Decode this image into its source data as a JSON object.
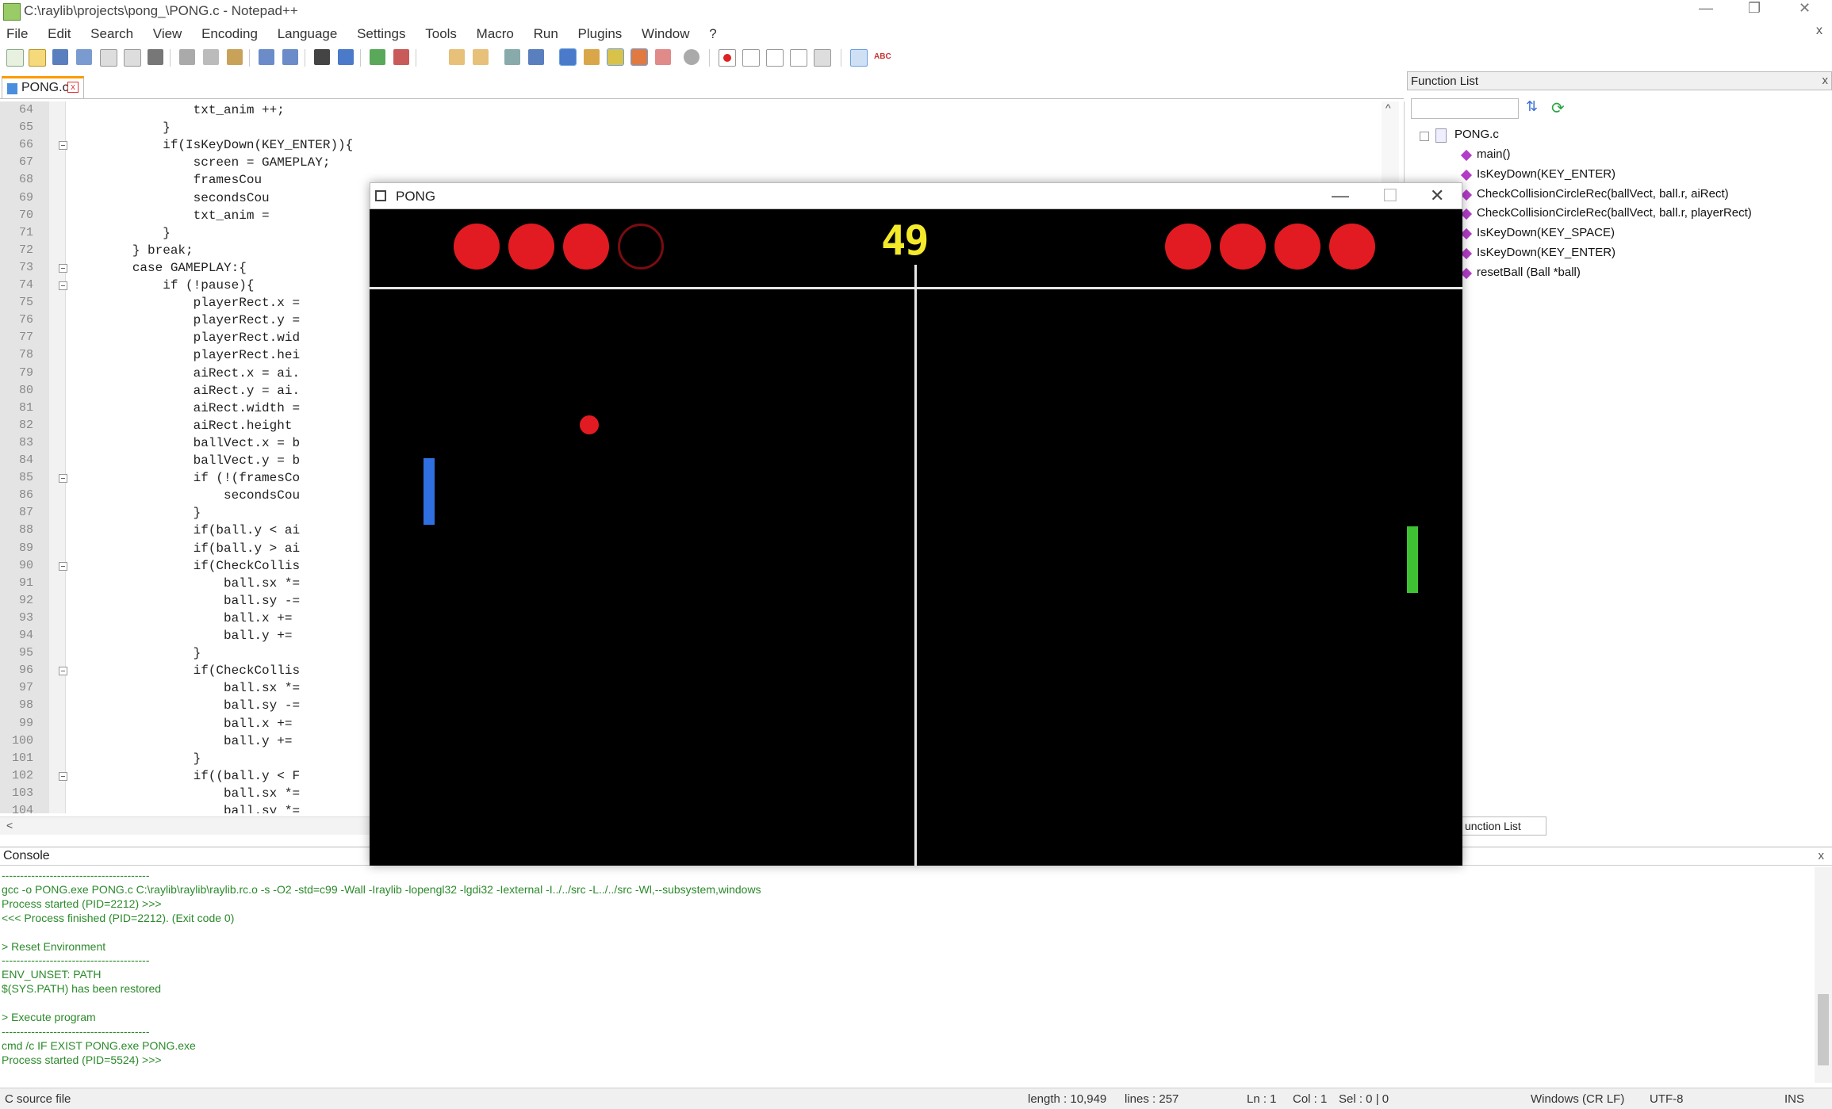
{
  "window": {
    "title": "C:\\raylib\\projects\\pong_\\PONG.c - Notepad++",
    "minimize": "—",
    "restore": "❐",
    "close": "✕",
    "doc_close": "x"
  },
  "menu": [
    "File",
    "Edit",
    "Search",
    "View",
    "Encoding",
    "Language",
    "Settings",
    "Tools",
    "Macro",
    "Run",
    "Plugins",
    "Window",
    "?"
  ],
  "tab": {
    "label": "PONG.c",
    "close": "x"
  },
  "editor": {
    "lines": [
      {
        "n": "64",
        "code": "                txt_anim ++;"
      },
      {
        "n": "65",
        "code": "            }"
      },
      {
        "n": "66",
        "code": "            if(IsKeyDown(KEY_ENTER)){"
      },
      {
        "n": "67",
        "code": "                screen = GAMEPLAY;"
      },
      {
        "n": "68",
        "code": "                framesCou"
      },
      {
        "n": "69",
        "code": "                secondsCou"
      },
      {
        "n": "70",
        "code": "                txt_anim ="
      },
      {
        "n": "71",
        "code": "            }"
      },
      {
        "n": "72",
        "code": "        } break;"
      },
      {
        "n": "73",
        "code": "        case GAMEPLAY:{"
      },
      {
        "n": "74",
        "code": "            if (!pause){"
      },
      {
        "n": "75",
        "code": "                playerRect.x ="
      },
      {
        "n": "76",
        "code": "                playerRect.y ="
      },
      {
        "n": "77",
        "code": "                playerRect.wid"
      },
      {
        "n": "78",
        "code": "                playerRect.hei"
      },
      {
        "n": "79",
        "code": "                aiRect.x = ai."
      },
      {
        "n": "80",
        "code": "                aiRect.y = ai."
      },
      {
        "n": "81",
        "code": "                aiRect.width ="
      },
      {
        "n": "82",
        "code": "                aiRect.height"
      },
      {
        "n": "83",
        "code": "                ballVect.x = b"
      },
      {
        "n": "84",
        "code": "                ballVect.y = b"
      },
      {
        "n": "85",
        "code": "                if (!(framesCo"
      },
      {
        "n": "86",
        "code": "                    secondsCou"
      },
      {
        "n": "87",
        "code": "                }"
      },
      {
        "n": "88",
        "code": "                if(ball.y < ai"
      },
      {
        "n": "89",
        "code": "                if(ball.y > ai"
      },
      {
        "n": "90",
        "code": "                if(CheckCollis"
      },
      {
        "n": "91",
        "code": "                    ball.sx *="
      },
      {
        "n": "92",
        "code": "                    ball.sy -="
      },
      {
        "n": "93",
        "code": "                    ball.x +="
      },
      {
        "n": "94",
        "code": "                    ball.y +="
      },
      {
        "n": "95",
        "code": "                }"
      },
      {
        "n": "96",
        "code": "                if(CheckCollis"
      },
      {
        "n": "97",
        "code": "                    ball.sx *="
      },
      {
        "n": "98",
        "code": "                    ball.sy -="
      },
      {
        "n": "99",
        "code": "                    ball.x +="
      },
      {
        "n": "100",
        "code": "                    ball.y +="
      },
      {
        "n": "101",
        "code": "                }"
      },
      {
        "n": "102",
        "code": "                if((ball.y < F"
      },
      {
        "n": "103",
        "code": "                    ball.sx *="
      },
      {
        "n": "104",
        "code": "                    ball.sy *="
      }
    ],
    "fold_lines": [
      "66",
      "73",
      "74",
      "85",
      "90",
      "96",
      "102"
    ],
    "scroll_up": "^",
    "scroll_left": "<"
  },
  "function_list": {
    "header": "Function List",
    "close": "x",
    "root": "PONG.c",
    "items": [
      "main()",
      "IsKeyDown(KEY_ENTER)",
      "CheckCollisionCircleRec(ballVect, ball.r, aiRect)",
      "CheckCollisionCircleRec(ballVect, ball.r, playerRect)",
      "IsKeyDown(KEY_SPACE)",
      "IsKeyDown(KEY_ENTER)",
      "resetBall (Ball *ball)"
    ],
    "tab_label": "unction List",
    "sort_icon": "sort-az-icon",
    "reload_icon": "reload-icon"
  },
  "console": {
    "header": "Console",
    "close": "x",
    "lines": [
      {
        "text": "----------------------------------------"
      },
      {
        "text": "gcc -o PONG.exe PONG.c C:\\raylib\\raylib\\raylib.rc.o -s -O2 -std=c99 -Wall -Iraylib -lopengl32 -lgdi32 -Iexternal -I../../src -L../../src -Wl,--subsystem,windows"
      },
      {
        "text": "Process started (PID=2212) >>>"
      },
      {
        "text": "<<< Process finished (PID=2212). (Exit code 0)"
      },
      {
        "text": ""
      },
      {
        "text": "> Reset Environment"
      },
      {
        "text": "----------------------------------------"
      },
      {
        "text": "ENV_UNSET: PATH"
      },
      {
        "text": "$(SYS.PATH) has been restored"
      },
      {
        "text": ""
      },
      {
        "text": "> Execute program"
      },
      {
        "text": "----------------------------------------"
      },
      {
        "text": "cmd /c IF EXIST PONG.exe PONG.exe"
      },
      {
        "text": "Process started (PID=5524) >>>"
      }
    ]
  },
  "status": {
    "type": "C source file",
    "length": "length : 10,949",
    "lines": "lines : 257",
    "ln": "Ln : 1",
    "col": "Col : 1",
    "sel": "Sel : 0 | 0",
    "eol": "Windows (CR LF)",
    "encoding": "UTF-8",
    "mode": "INS"
  },
  "pong": {
    "title": "PONG",
    "minimize": "—",
    "maximize": "☐",
    "close": "✕",
    "timer": "49",
    "player_lives": {
      "remaining": 3,
      "total": 4
    },
    "ai_lives": {
      "remaining": 4,
      "total": 4
    },
    "colors": {
      "ball": "#e21b22",
      "player_paddle": "#2f6fe0",
      "ai_paddle": "#3ec233",
      "timer": "#f4ea2a",
      "background": "#000000"
    }
  }
}
